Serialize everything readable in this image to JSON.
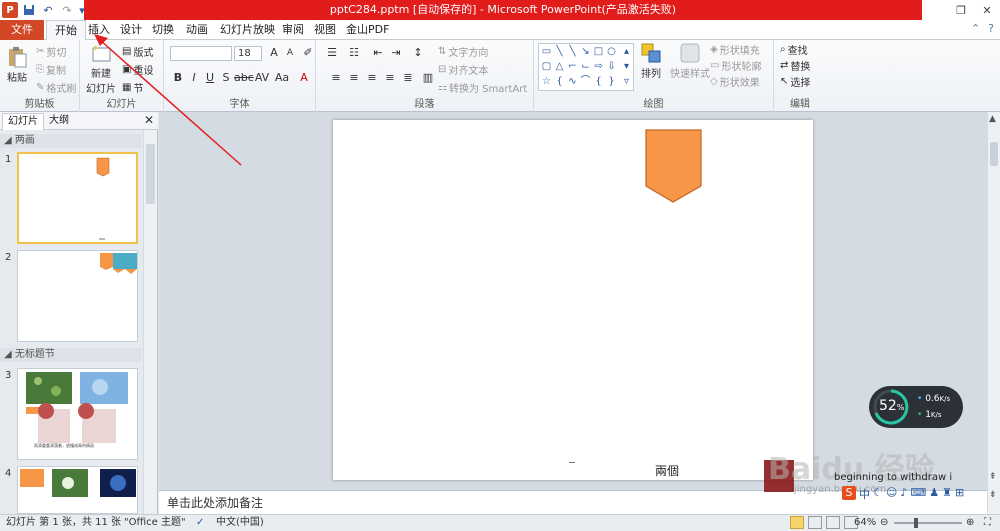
{
  "window": {
    "title": "pptC284.pptm [自动保存的] - Microsoft PowerPoint(产品激活失败)",
    "minimize_icon": "restore-icon",
    "close_icon": "close-icon"
  },
  "quick_access": [
    "ppt-logo-icon",
    "save-icon",
    "undo-icon",
    "redo-icon"
  ],
  "tabs": {
    "file": "文件",
    "items": [
      "开始",
      "插入",
      "设计",
      "切换",
      "动画",
      "幻灯片放映",
      "审阅",
      "视图",
      "金山PDF"
    ],
    "active": "开始"
  },
  "ribbon": {
    "clipboard": {
      "label": "剪贴板",
      "paste": "粘贴",
      "cut": "剪切",
      "copy": "复制",
      "format_painter": "格式刷"
    },
    "slides": {
      "label": "幻灯片",
      "new_slide_line1": "新建",
      "new_slide_line2": "幻灯片",
      "layout": "版式",
      "reset": "重设",
      "section": "节"
    },
    "font": {
      "label": "字体",
      "font_name": "",
      "font_size": "18"
    },
    "paragraph": {
      "label": "段落",
      "text_direction": "文字方向",
      "align_text": "对齐文本",
      "smartart": "转换为 SmartArt"
    },
    "drawing": {
      "label": "绘图",
      "arrange": "排列",
      "quick_styles": "快速样式",
      "shape_fill": "形状填充",
      "shape_outline": "形状轮廓",
      "shape_effects": "形状效果"
    },
    "editing": {
      "label": "编辑",
      "find": "查找",
      "replace": "替换",
      "select": "选择"
    }
  },
  "left_pane": {
    "tab_slides": "幻灯片",
    "tab_outline": "大纲",
    "sections": [
      "两画",
      "无标题节"
    ],
    "slides": [
      "1",
      "2",
      "3",
      "4"
    ],
    "slide3_caption": "雨滴重重滴落着，放撞成青的情丽"
  },
  "slide": {
    "caption": "兩個",
    "shape_color": "#f79646",
    "shape_stroke": "#c0662a"
  },
  "notes_placeholder": "单击此处添加备注",
  "status": {
    "slide_info": "幻灯片 第 1 张，共 11 张",
    "theme": "\"Office 主题\"",
    "language": "中文(中国)",
    "zoom": "64%"
  },
  "speed_widget": {
    "percent": "52",
    "percent_sign": "%",
    "upload": "0.6",
    "upload_unit": "K/s",
    "download": "1",
    "download_unit": "K/s"
  },
  "watermark": {
    "text": "Baidu 经验",
    "url": "jingyan.baidu.com",
    "subtitle": "beginning to withdraw i"
  },
  "colors": {
    "accent_red": "#e21b1b",
    "file_tab": "#d24726"
  }
}
